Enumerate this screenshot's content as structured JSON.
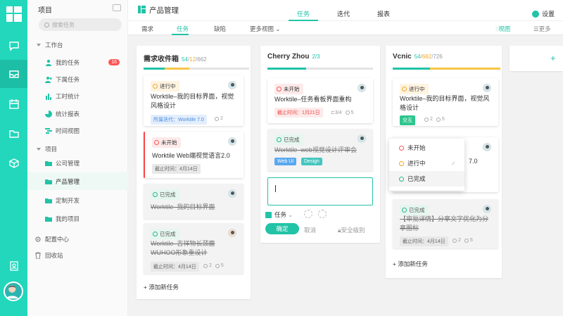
{
  "sidebar": {
    "title": "项目",
    "search_placeholder": "搜索任务",
    "workbench_label": "工作台",
    "my_tasks": "我的任务",
    "my_tasks_badge": "16",
    "subordinate_tasks": "下属任务",
    "hours": "工时统计",
    "reports": "统计报表",
    "timeline": "时间视图",
    "projects_label": "项目",
    "projects": [
      "公司管理",
      "产品管理",
      "定制开发",
      "我的项目"
    ],
    "active_project_index": 1,
    "config": "配置中心",
    "recycle": "回收站"
  },
  "header": {
    "project_name": "产品管理",
    "tabs": [
      "任务",
      "迭代",
      "报表"
    ],
    "active_tab": 0,
    "settings": "设置"
  },
  "subnav": {
    "tabs": [
      "需求",
      "任务",
      "缺陷",
      "更多视图"
    ],
    "active": 1,
    "view": "视图",
    "more": "更多"
  },
  "columns": [
    {
      "title": "需求收件箱",
      "count_done": "54",
      "count_mid": "12",
      "count_total": "662",
      "cards": [
        {
          "status": "进行中",
          "title": "Worktile–我的目标界面，视觉风格设计",
          "tag": "所属迭代：Worktile 7.0",
          "count": "2"
        },
        {
          "status": "未开始",
          "title": "Worktile Web端视觉语言2.0",
          "due": "截止时间：4月14日"
        },
        {
          "status": "已完成",
          "title": "Worktile–我的目标界面"
        },
        {
          "status": "已完成",
          "title": "Worktile–吉祥物长颈鹿 WUHOO形象重设计",
          "due": "截止时间：4月14日",
          "c1": "2",
          "c2": "5"
        }
      ],
      "add": "+ 添加新任务"
    },
    {
      "title": "Cherry Zhou",
      "count": "2/3",
      "cards": [
        {
          "status": "未开始",
          "title": "Worktile–任务看板界面重构",
          "due": "截止时间：1月21日",
          "sub": "3/4",
          "c2": "5"
        },
        {
          "status": "已完成",
          "title": "Worktile–web视觉设计评审会",
          "tags": [
            "Web UI",
            "Design"
          ]
        }
      ],
      "type_label": "任务",
      "confirm": "确定",
      "cancel": "取消",
      "security": "安全级别"
    },
    {
      "title": "Vcnic",
      "count_done": "54",
      "count_mid": "662",
      "count_total": "726",
      "cards": [
        {
          "status": "进行中",
          "title": "Worktile–我的目标界面，视觉风格设计",
          "tag": "交互",
          "c1": "2",
          "c2": "5"
        },
        {
          "partial": "7.0"
        },
        {
          "status": "已完成",
          "title": "【审批详情】分享文字优化为分享图标",
          "due": "截止时间：4月14日",
          "c1": "2",
          "c2": "5"
        }
      ],
      "add": "+ 添加新任务"
    }
  ],
  "dropdown": [
    "未开始",
    "进行中",
    "已完成"
  ],
  "add_column": "+",
  "colors": {
    "accent": "#22c3a7",
    "rail": "#22d7bb",
    "progress": "#f5a623",
    "new": "#ff5555",
    "done": "#2cb58a"
  }
}
